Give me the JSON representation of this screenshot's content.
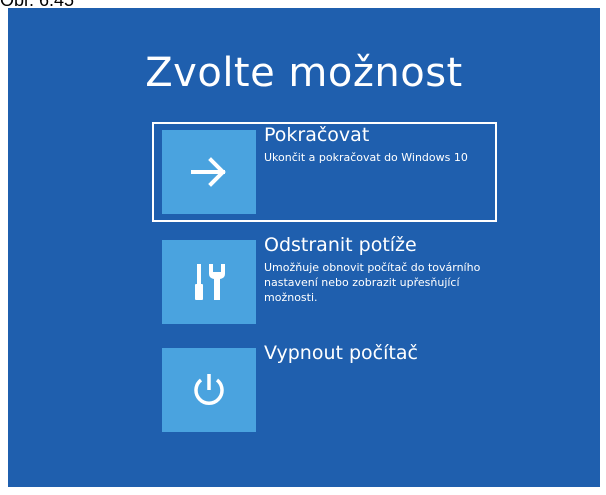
{
  "caption": "Obr. 6.45",
  "screen": {
    "background": "#1f5fae",
    "tile_color": "#4aa3df",
    "title": "Zvolte možnost",
    "options": [
      {
        "title": "Pokračovat",
        "description": "Ukončit a pokračovat do Windows 10",
        "icon": "arrow-right-icon",
        "selected": true
      },
      {
        "title": "Odstranit potíže",
        "description": "Umožňuje obnovit počítač do továrního nastavení nebo zobrazit upřesňující možnosti.",
        "icon": "troubleshoot-tools-icon",
        "selected": false
      },
      {
        "title": "Vypnout počítač",
        "description": "",
        "icon": "power-icon",
        "selected": false
      }
    ]
  }
}
